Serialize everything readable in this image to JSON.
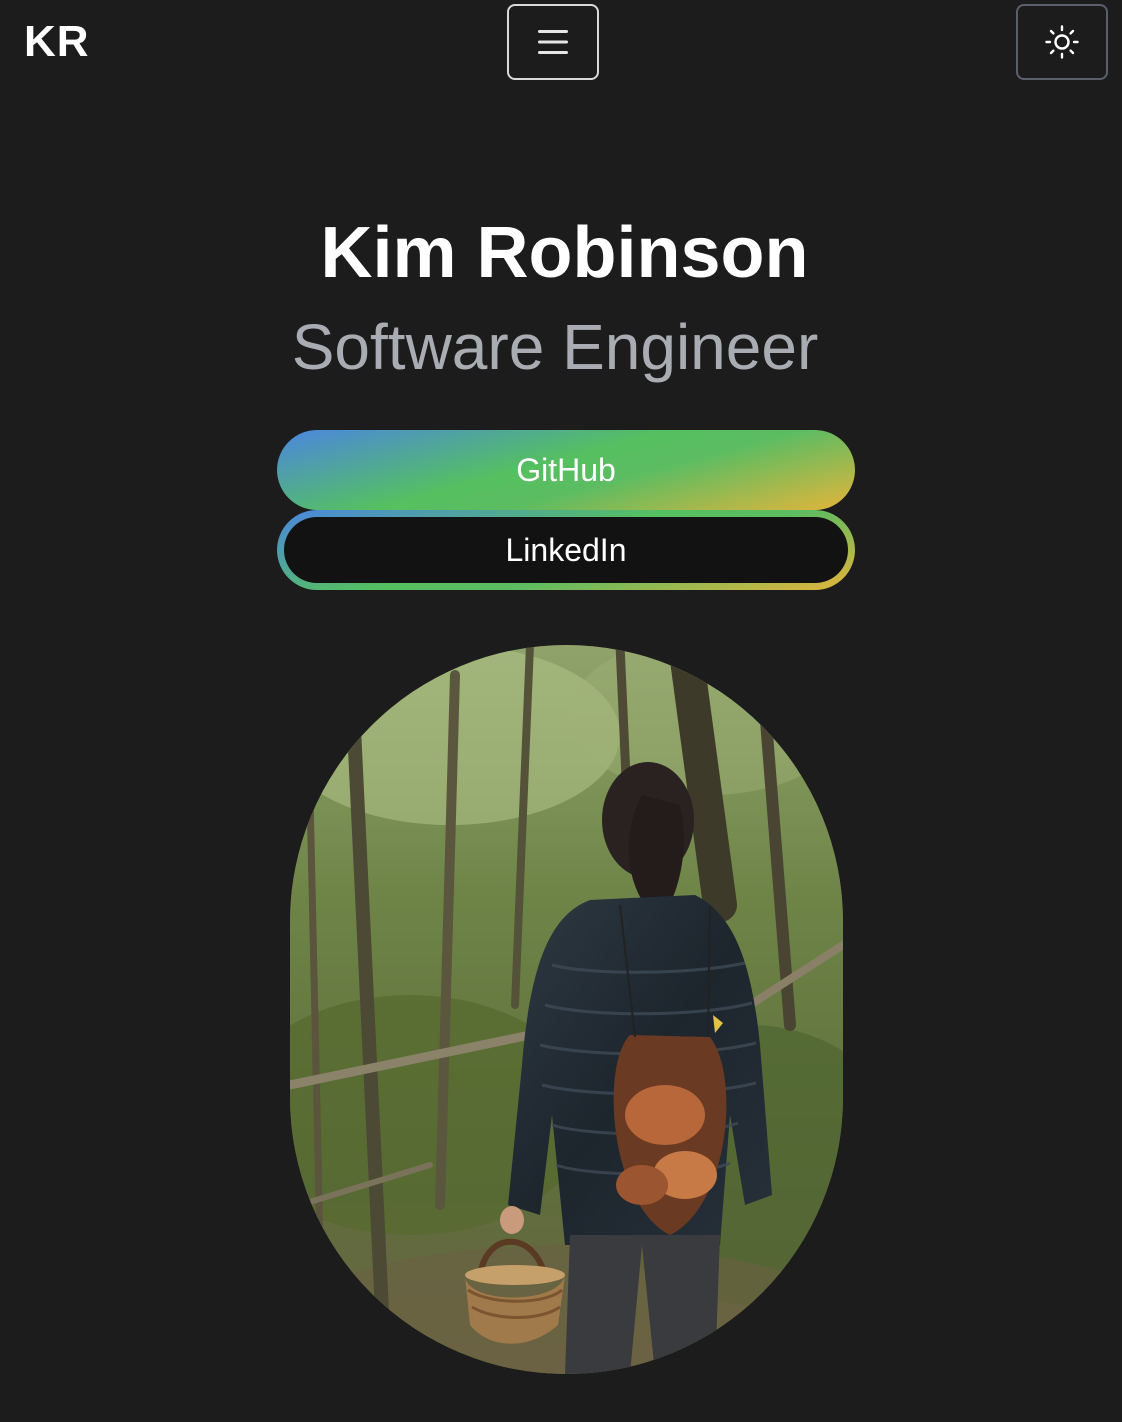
{
  "header": {
    "logo": "KR",
    "menu_icon": "hamburger-menu-icon",
    "theme_icon": "sun-icon"
  },
  "hero": {
    "name": "Kim Robinson",
    "title": "Software Engineer"
  },
  "links": {
    "github_label": "GitHub",
    "linkedin_label": "LinkedIn"
  },
  "photo": {
    "alt_subject": "person in a forest holding a basket and a mesh bag of mushrooms"
  },
  "colors": {
    "background": "#1c1c1c",
    "name": "#ffffff",
    "title": "#a9adb3",
    "gradient_blue": "#4a86e0",
    "gradient_green": "#55c060",
    "gradient_yellow": "#e4b53a",
    "linkedin_fill": "#121212"
  }
}
